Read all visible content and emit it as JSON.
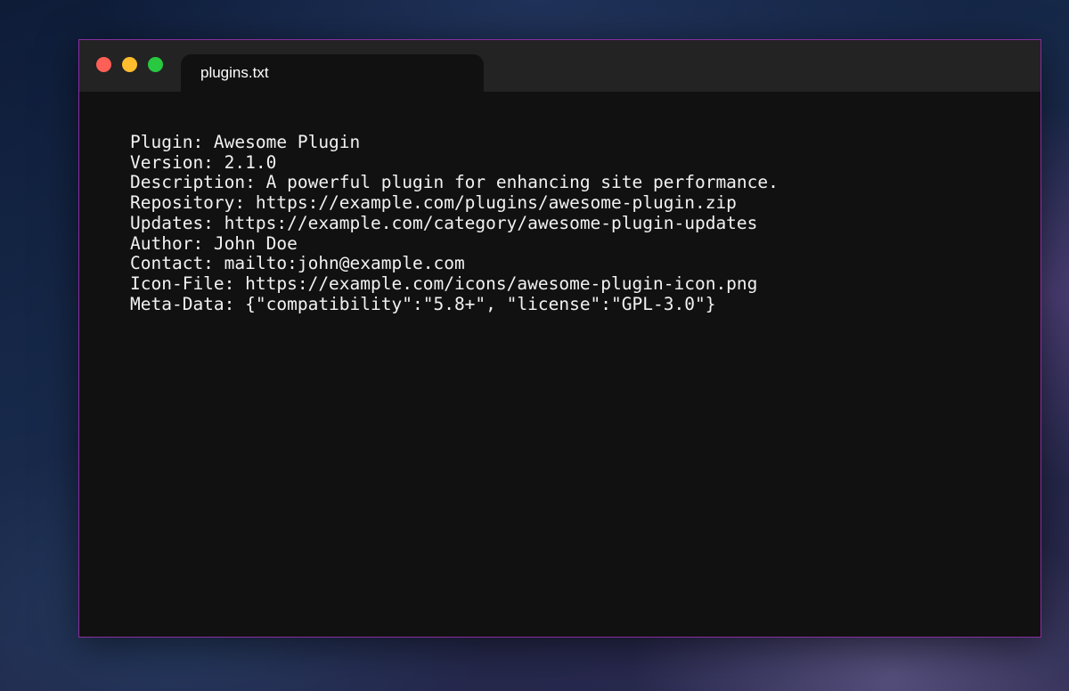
{
  "tab": {
    "title": "plugins.txt"
  },
  "file": {
    "lines": [
      "Plugin: Awesome Plugin",
      "Version: 2.1.0",
      "Description: A powerful plugin for enhancing site performance.",
      "Repository: https://example.com/plugins/awesome-plugin.zip",
      "Updates: https://example.com/category/awesome-plugin-updates",
      "Author: John Doe",
      "Contact: mailto:john@example.com",
      "Icon-File: https://example.com/icons/awesome-plugin-icon.png",
      "Meta-Data: {\"compatibility\":\"5.8+\", \"license\":\"GPL-3.0\"}"
    ]
  },
  "colors": {
    "close": "#fe5f57",
    "minimize": "#febc2e",
    "maximize": "#28c840",
    "window_border": "#8a2ea0",
    "editor_background": "#111111",
    "titlebar_background": "#232323"
  }
}
